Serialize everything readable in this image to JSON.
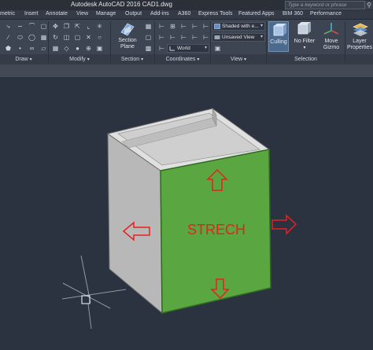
{
  "window": {
    "title": "Autodesk AutoCAD 2016    CAD1.dwg",
    "search_placeholder": "Type a keyword or phrase",
    "search_icon": "search-icon"
  },
  "ribbon_tabs": [
    {
      "label": "metric"
    },
    {
      "label": "Insert"
    },
    {
      "label": "Annotate"
    },
    {
      "label": "View"
    },
    {
      "label": "Manage"
    },
    {
      "label": "Output"
    },
    {
      "label": "Add-ins"
    },
    {
      "label": "A360"
    },
    {
      "label": "Express Tools"
    },
    {
      "label": "Featured Apps"
    },
    {
      "label": "BIM 360"
    },
    {
      "label": "Performance"
    }
  ],
  "panels": {
    "draw": "Draw",
    "modify": "Modify",
    "section": "Section",
    "coordinates": "Coordinates",
    "view": "View",
    "selection": "Selection"
  },
  "buttons": {
    "section_plane": [
      "Section",
      "Plane"
    ],
    "culling": "Culling",
    "no_filter": "No Filter",
    "move_gizmo": [
      "Move",
      "Gizmo"
    ],
    "layer_properties": [
      "Layer",
      "Properties"
    ]
  },
  "dropdowns": {
    "visual_style": "Shaded with e...",
    "named_view": "Unsaved View",
    "ucs": "World"
  },
  "canvas": {
    "annotation_text": "STRECH",
    "annotation_color": "#e82020",
    "face_color": "#5aa640",
    "box_color": "#cfcfcf"
  }
}
